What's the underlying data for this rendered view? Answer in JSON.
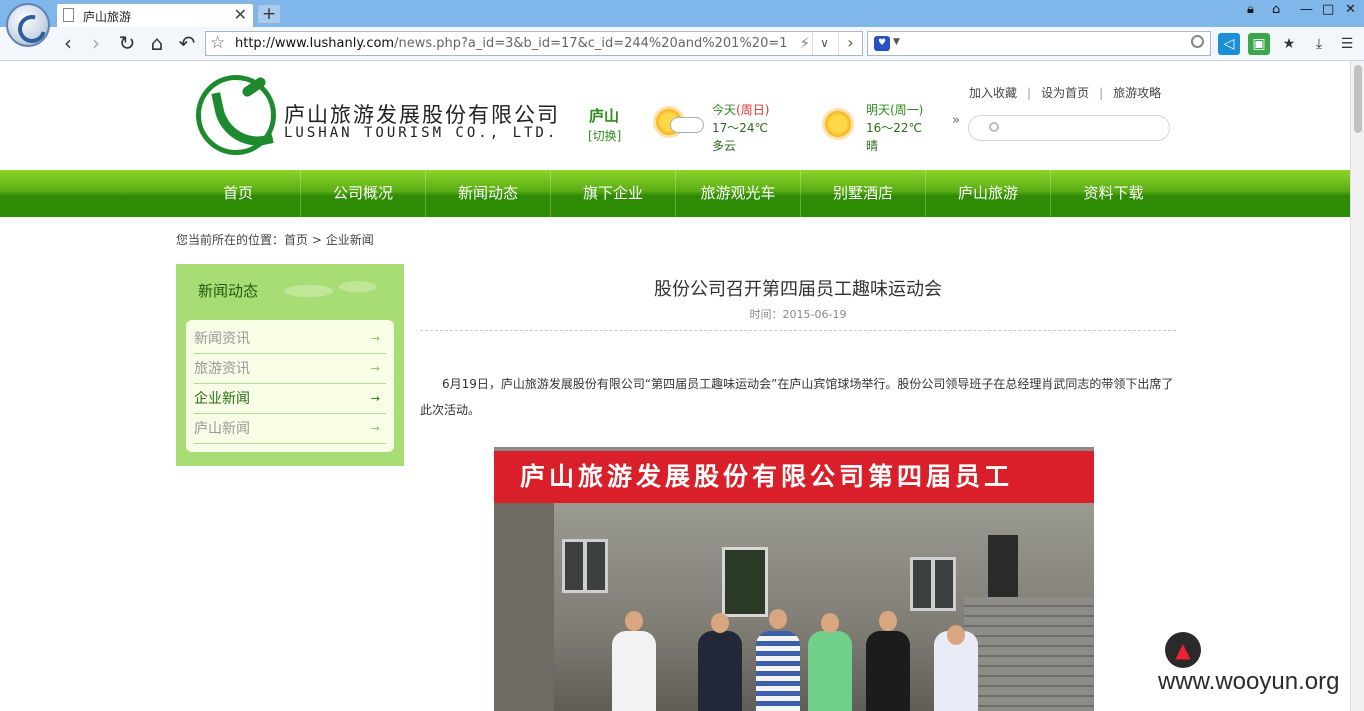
{
  "browser": {
    "tab_title": "庐山旅游",
    "tab_close": "✕",
    "new_tab": "+",
    "url_host": "http://www.lushanly.com",
    "url_path": "/news.php?a_id=3&b_id=17&c_id=244%20and%201%20=1"
  },
  "header": {
    "logo_cn": "庐山旅游发展股份有限公司",
    "logo_en": "LUSHAN TOURISM  CO., LTD.",
    "city": "庐山",
    "city_switch": "[切换]",
    "today_label": "今天",
    "today_day": "(周日)",
    "today_temp": "17～24℃",
    "today_cond": "多云",
    "tomorrow_label": "明天(周一)",
    "tomorrow_temp": "16～22℃",
    "tomorrow_cond": "晴",
    "more": "»",
    "links": [
      "加入收藏",
      "设为首页",
      "旅游攻略"
    ],
    "link_sep": "|"
  },
  "nav": [
    "首页",
    "公司概况",
    "新闻动态",
    "旗下企业",
    "旅游观光车",
    "别墅酒店",
    "庐山旅游",
    "资料下载"
  ],
  "breadcrumb": {
    "prefix": "您当前所在的位置：",
    "home": "首页",
    "sep": " > ",
    "current": "企业新闻"
  },
  "sidebar": {
    "title": "新闻动态",
    "items": [
      {
        "label": "新闻资讯",
        "arrow": "→"
      },
      {
        "label": "旅游资讯",
        "arrow": "→"
      },
      {
        "label": "企业新闻",
        "arrow": "→"
      },
      {
        "label": "庐山新闻",
        "arrow": "→"
      }
    ]
  },
  "article": {
    "title": "股份公司召开第四届员工趣味运动会",
    "time": "时间：2015-06-19",
    "body": "6月19日，庐山旅游发展股份有限公司“第四届员工趣味运动会”在庐山宾馆球场举行。股份公司领导班子在总经理肖武同志的带领下出席了此次活动。",
    "photo_banner": "庐山旅游发展股份有限公司第四届员工"
  },
  "watermark": "www.wooyun.org",
  "colors": {
    "nav_green": "#3c9a0a",
    "side_green": "#a7dd74",
    "accent_text": "#2e8b1e"
  }
}
